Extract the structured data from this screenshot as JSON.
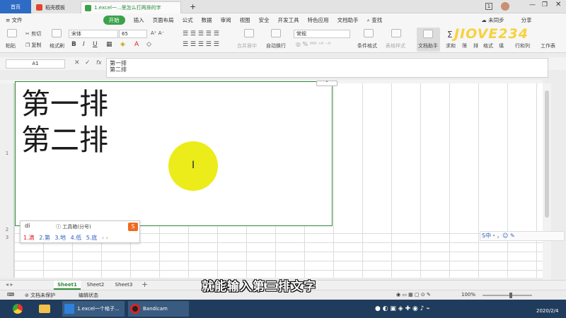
{
  "titlebar": {
    "home_tab": "首页",
    "template_tab": "稻壳模板",
    "doc_tab": "1.excel一...里怎么打两排的字",
    "new_tab": "+",
    "page_number": "1"
  },
  "menubar": {
    "file": "文件",
    "start": "开始",
    "items": [
      "插入",
      "页面布局",
      "公式",
      "数据",
      "审阅",
      "视图",
      "安全",
      "开发工具",
      "特色应用",
      "文档助手",
      "查找"
    ],
    "unsync": "未同步",
    "share": "分享"
  },
  "ribbon": {
    "paste": "粘贴",
    "cut": "剪切",
    "copy": "复制",
    "format_painter": "格式刷",
    "font_name": "宋体",
    "font_size": "65",
    "bold": "B",
    "italic": "I",
    "underline": "U",
    "merge_center": "合并居中",
    "wrap": "自动换行",
    "number_format": "常规",
    "conditional_format": "条件格式",
    "table_style": "表格样式",
    "doc_assistant": "文档助手",
    "sum": "求和",
    "filter_short": "筛",
    "sort_short": "排",
    "format_short": "格式",
    "fill_short": "填",
    "rowcol": "行和列",
    "worksheet": "工作表",
    "logo_text": "JIOVE234"
  },
  "formula": {
    "cell_ref": "A1",
    "line1": "第一排",
    "line2": "第二排"
  },
  "grid": {
    "cell_line1": "第一排",
    "cell_line2": "第二排",
    "rows": [
      "1",
      "2",
      "3"
    ]
  },
  "ime": {
    "pinyin": "di",
    "toolbox": "工具箱(分号)",
    "candidates": [
      "1.滴",
      "2.第",
      "3.地",
      "4.低",
      "5.底"
    ],
    "sogou": "S",
    "bar": "S中・，☺ ✎"
  },
  "sheets": [
    "Sheet1",
    "Sheet2",
    "Sheet3"
  ],
  "status": {
    "doc_protect": "文档未保护",
    "edit_state": "编辑状态",
    "zoom": "100%"
  },
  "caption": "就能输入第三排文字",
  "taskbar": {
    "excel_app": "1.excel一个格子...",
    "bandicam": "Bandicam",
    "date": "2020/2/4"
  },
  "colors": {
    "accent_green": "#2e8b3a",
    "home_blue": "#2e6bc4",
    "cursor_yellow": "#ecec1a"
  }
}
